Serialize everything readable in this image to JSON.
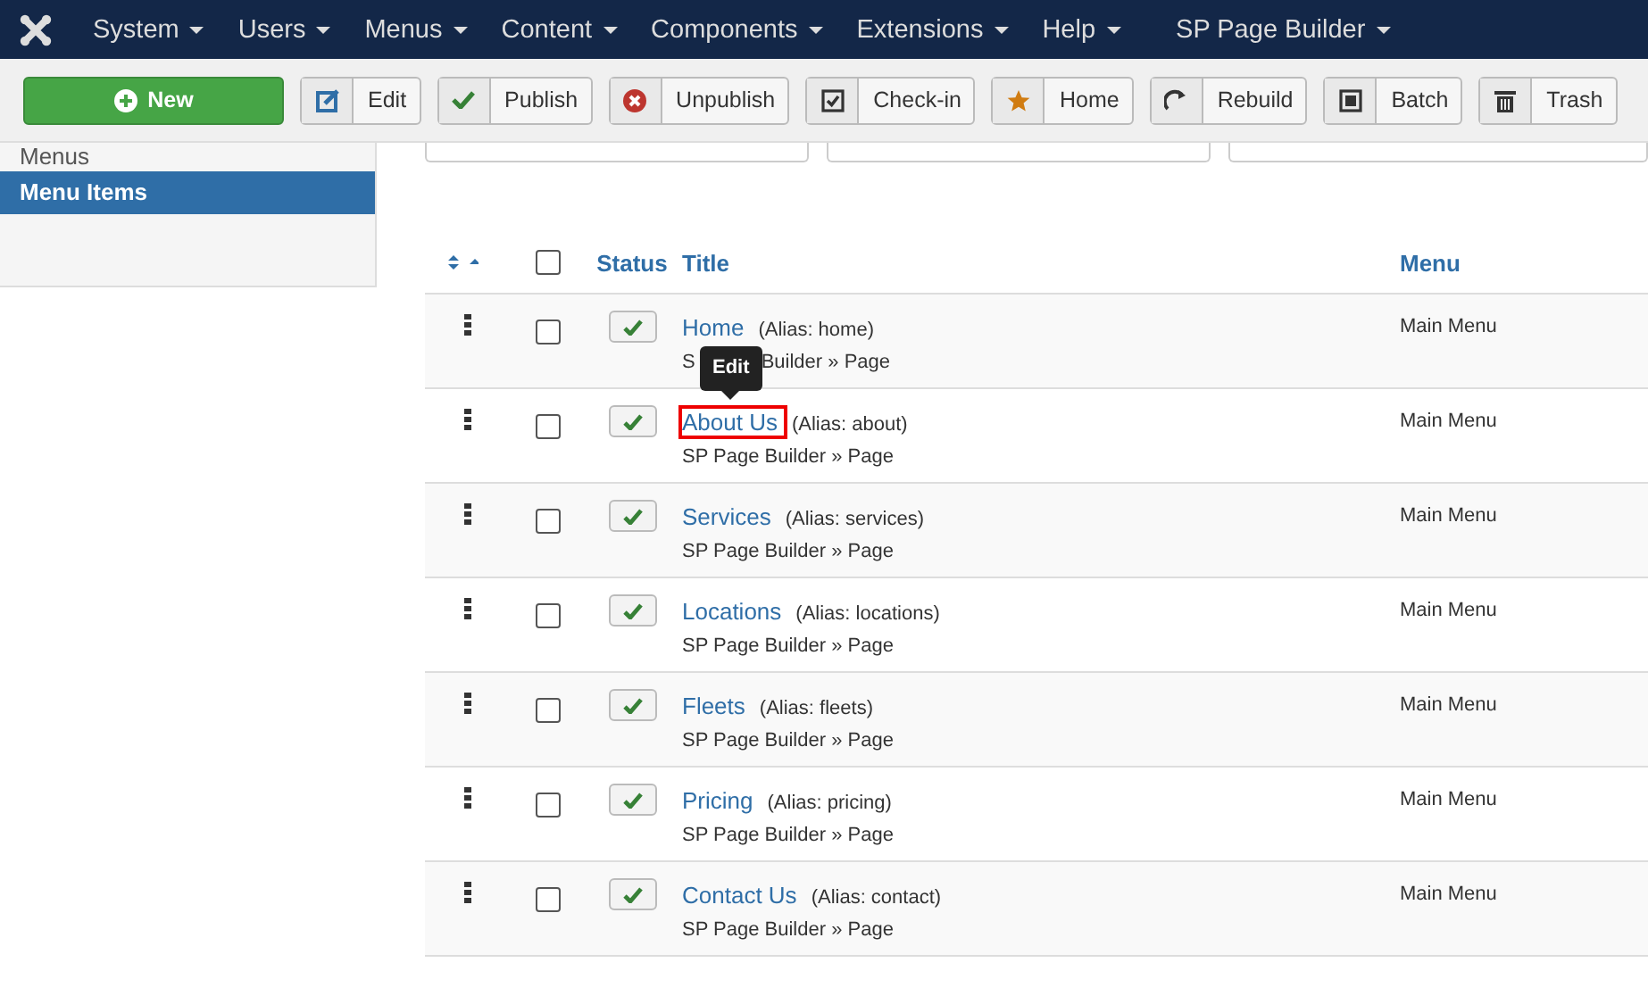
{
  "menubar": [
    {
      "label": "System"
    },
    {
      "label": "Users"
    },
    {
      "label": "Menus"
    },
    {
      "label": "Content"
    },
    {
      "label": "Components"
    },
    {
      "label": "Extensions"
    },
    {
      "label": "Help"
    },
    {
      "label": "SP Page Builder"
    }
  ],
  "toolbar": [
    {
      "label": "New",
      "kind": "new"
    },
    {
      "label": "Edit",
      "kind": "edit"
    },
    {
      "label": "Publish",
      "kind": "publish"
    },
    {
      "label": "Unpublish",
      "kind": "unpublish"
    },
    {
      "label": "Check-in",
      "kind": "checkin"
    },
    {
      "label": "Home",
      "kind": "home"
    },
    {
      "label": "Rebuild",
      "kind": "rebuild"
    },
    {
      "label": "Batch",
      "kind": "batch"
    },
    {
      "label": "Trash",
      "kind": "trash"
    }
  ],
  "sidebar": {
    "items": [
      {
        "label": "Menus",
        "selected": false
      },
      {
        "label": "Menu Items",
        "selected": true
      }
    ]
  },
  "table": {
    "select_all": {
      "checked": false
    },
    "columns": [
      "Status",
      "Title",
      "Menu"
    ],
    "rows": [
      {
        "title": "Home",
        "alias": "(Alias: home)",
        "type": "S",
        "type_continued": "Builder » Page",
        "menu": "Main Menu",
        "published": true,
        "checked": false,
        "highlighted": false
      },
      {
        "title": "About Us",
        "alias": "(Alias: about)",
        "type": "SP Page Builder » Page",
        "menu": "Main Menu",
        "published": true,
        "checked": false,
        "highlighted": true,
        "tooltip": "Edit"
      },
      {
        "title": "Services",
        "alias": "(Alias: services)",
        "type": "SP Page Builder » Page",
        "menu": "Main Menu",
        "published": true,
        "checked": false,
        "highlighted": false
      },
      {
        "title": "Locations",
        "alias": "(Alias: locations)",
        "type": "SP Page Builder » Page",
        "menu": "Main Menu",
        "published": true,
        "checked": false,
        "highlighted": false
      },
      {
        "title": "Fleets",
        "alias": "(Alias: fleets)",
        "type": "SP Page Builder » Page",
        "menu": "Main Menu",
        "published": true,
        "checked": false,
        "highlighted": false
      },
      {
        "title": "Pricing",
        "alias": "(Alias: pricing)",
        "type": "SP Page Builder » Page",
        "menu": "Main Menu",
        "published": true,
        "checked": false,
        "highlighted": false
      },
      {
        "title": "Contact Us",
        "alias": "(Alias: contact)",
        "type": "SP Page Builder » Page",
        "menu": "Main Menu",
        "published": true,
        "checked": false,
        "highlighted": false
      }
    ]
  }
}
